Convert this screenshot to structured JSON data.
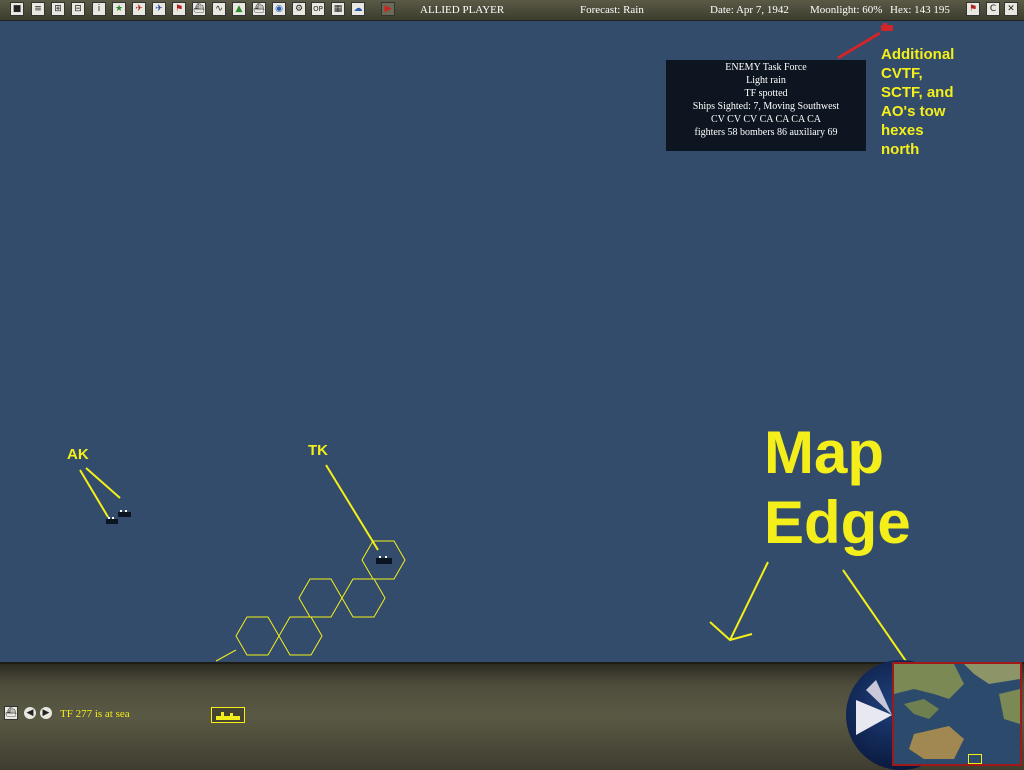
{
  "toolbar": {
    "player": "ALLIED PLAYER",
    "forecast": "Forecast: Rain",
    "date": "Date: Apr 7, 1942",
    "moonlight": "Moonlight: 60%",
    "hex": "Hex: 143 195",
    "btn_op": "OP",
    "btn_c": "C"
  },
  "popup": {
    "lines": [
      "ENEMY Task Force",
      "Light rain",
      "TF spotted",
      "Ships Sighted: 7, Moving Southwest",
      "CV CV CV CA CA CA CA",
      "fighters 58  bombers 86  auxiliary 69"
    ]
  },
  "annotations": {
    "additional": [
      "Additional",
      "CVTF,",
      "SCTF, and",
      "AO's tow",
      "hexes",
      "north"
    ],
    "ak": "AK",
    "tk": "TK",
    "map_edge": [
      "Map",
      "Edge"
    ]
  },
  "bottom": {
    "status": "TF 277 is at sea"
  },
  "colors": {
    "ocean": "#334c6b",
    "annotation": "#f4ef1a",
    "pointer_red": "#d0262a"
  }
}
